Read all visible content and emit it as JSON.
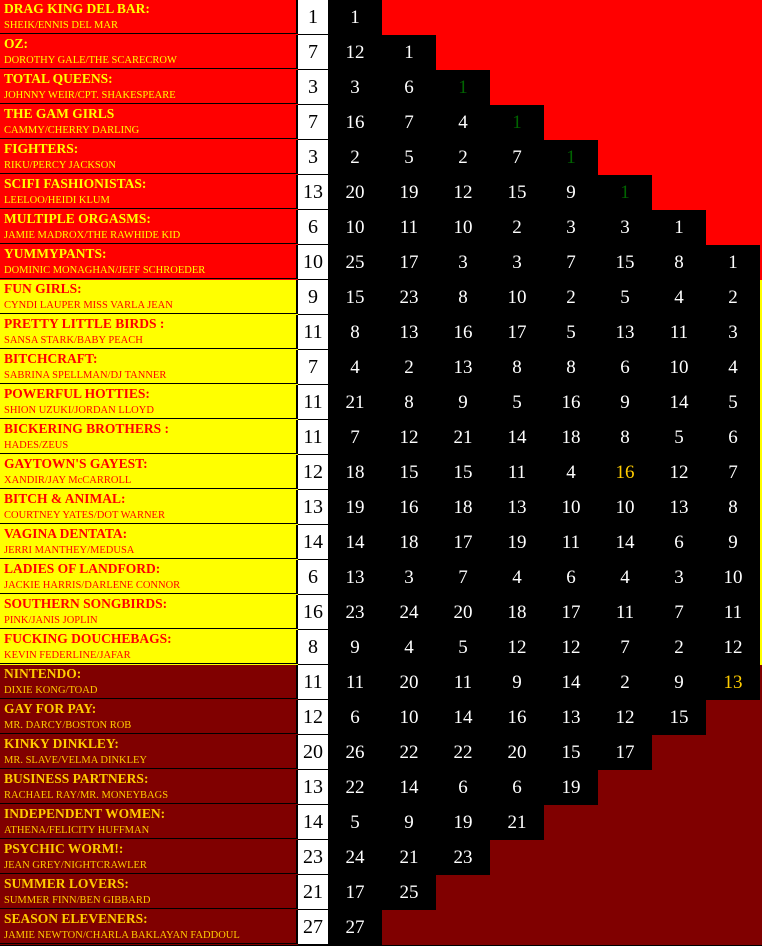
{
  "colors": {
    "red_group": "#ff0000",
    "yellow_group": "#ffff00",
    "darkred_group": "#800000",
    "text_on_red": "#ffff00",
    "text_on_yellow": "#ff0000",
    "text_on_darkred": "#ffcc00",
    "green_highlight": "#006400",
    "gold_highlight": "#ffcc00",
    "score_bg": "#000000",
    "total_bg": "#ffffff"
  },
  "rows": [
    {
      "group": "red",
      "team": "DRAG KING DEL BAR:",
      "pair": "SHEIK/ENNIS DEL MAR",
      "total": "1",
      "scores": [
        "1"
      ]
    },
    {
      "group": "red",
      "team": "OZ:",
      "pair": "DOROTHY GALE/THE SCARECROW",
      "total": "7",
      "scores": [
        "12",
        "1"
      ]
    },
    {
      "group": "red",
      "team": "TOTAL QUEENS:",
      "pair": "JOHNNY WEIR/CPT. SHAKESPEARE",
      "total": "3",
      "scores": [
        "3",
        "6",
        {
          "value": "1",
          "highlight": "green"
        }
      ]
    },
    {
      "group": "red",
      "team": "THE GAM GIRLS",
      "pair": "CAMMY/CHERRY DARLING",
      "total": "7",
      "scores": [
        "16",
        "7",
        "4",
        {
          "value": "1",
          "highlight": "green"
        }
      ]
    },
    {
      "group": "red",
      "team": "FIGHTERS:",
      "pair": "RIKU/PERCY JACKSON",
      "total": "3",
      "scores": [
        "2",
        "5",
        "2",
        "7",
        {
          "value": "1",
          "highlight": "green"
        }
      ]
    },
    {
      "group": "red",
      "team": "SCIFI FASHIONISTAS:",
      "pair": " LEELOO/HEIDI KLUM",
      "total": "13",
      "scores": [
        "20",
        "19",
        "12",
        "15",
        "9",
        {
          "value": "1",
          "highlight": "green"
        }
      ]
    },
    {
      "group": "red",
      "team": "MULTIPLE ORGASMS:",
      "pair": "JAMIE MADROX/THE RAWHIDE KID",
      "total": "6",
      "scores": [
        "10",
        "11",
        "10",
        "2",
        "3",
        "3",
        "1"
      ]
    },
    {
      "group": "red",
      "team": "YUMMYPANTS:",
      "pair": "DOMINIC MONAGHAN/JEFF SCHROEDER",
      "total": "10",
      "scores": [
        "25",
        "17",
        "3",
        "3",
        "7",
        "15",
        "8",
        "1"
      ]
    },
    {
      "group": "yellow",
      "team": "FUN GIRLS:",
      "pair": "CYNDI LAUPER MISS VARLA JEAN",
      "total": "9",
      "scores": [
        "15",
        "23",
        "8",
        "10",
        "2",
        "5",
        "4",
        "2"
      ]
    },
    {
      "group": "yellow",
      "team": "PRETTY LITTLE BIRDS :",
      "pair": "SANSA STARK/BABY PEACH",
      "total": "11",
      "scores": [
        "8",
        "13",
        "16",
        "17",
        "5",
        "13",
        "11",
        "3"
      ]
    },
    {
      "group": "yellow",
      "team": "BITCHCRAFT:",
      "pair": "SABRINA SPELLMAN/DJ TANNER",
      "total": "7",
      "scores": [
        "4",
        "2",
        "13",
        "8",
        "8",
        "6",
        "10",
        "4"
      ]
    },
    {
      "group": "yellow",
      "team": "POWERFUL HOTTIES:",
      "pair": "SHION UZUKI/JORDAN LLOYD",
      "total": "11",
      "scores": [
        "21",
        "8",
        "9",
        "5",
        "16",
        "9",
        "14",
        "5"
      ]
    },
    {
      "group": "yellow",
      "team": "BICKERING BROTHERS :",
      "pair": " HADES/ZEUS",
      "total": "11",
      "scores": [
        "7",
        "12",
        "21",
        "14",
        "18",
        "8",
        "5",
        "6"
      ]
    },
    {
      "group": "yellow",
      "team": "GAYTOWN'S GAYEST:",
      "pair": "XANDIR/JAY McCARROLL",
      "total": "12",
      "scores": [
        "18",
        "15",
        "15",
        "11",
        "4",
        {
          "value": "16",
          "highlight": "gold"
        },
        "12",
        "7"
      ]
    },
    {
      "group": "yellow",
      "team": "BITCH & ANIMAL:",
      "pair": "COURTNEY YATES/DOT WARNER",
      "total": "13",
      "scores": [
        "19",
        "16",
        "18",
        "13",
        "10",
        "10",
        "13",
        "8"
      ]
    },
    {
      "group": "yellow",
      "team": "VAGINA DENTATA:",
      "pair": "JERRI MANTHEY/MEDUSA",
      "total": "14",
      "scores": [
        "14",
        "18",
        "17",
        "19",
        "11",
        "14",
        "6",
        "9"
      ]
    },
    {
      "group": "yellow",
      "team": "LADIES OF LANDFORD:",
      "pair": "JACKIE HARRIS/DARLENE CONNOR",
      "total": "6",
      "scores": [
        "13",
        "3",
        "7",
        "4",
        "6",
        "4",
        "3",
        "10"
      ]
    },
    {
      "group": "yellow",
      "team": "SOUTHERN SONGBIRDS:",
      "pair": "PINK/JANIS JOPLIN",
      "total": "16",
      "scores": [
        "23",
        "24",
        "20",
        "18",
        "17",
        "11",
        "7",
        "11"
      ]
    },
    {
      "group": "yellow",
      "team": "FUCKING DOUCHEBAGS:",
      "pair": "KEVIN FEDERLINE/JAFAR",
      "total": "8",
      "scores": [
        "9",
        "4",
        "5",
        "12",
        "12",
        "7",
        "2",
        "12"
      ]
    },
    {
      "group": "darkred",
      "team": "NINTENDO:",
      "pair": "DIXIE KONG/TOAD",
      "total": "11",
      "scores": [
        "11",
        "20",
        "11",
        "9",
        "14",
        "2",
        "9",
        {
          "value": "13",
          "highlight": "gold"
        }
      ]
    },
    {
      "group": "darkred",
      "team": "GAY FOR PAY:",
      "pair": "MR. DARCY/BOSTON ROB",
      "total": "12",
      "scores": [
        "6",
        "10",
        "14",
        "16",
        "13",
        "12",
        "15"
      ]
    },
    {
      "group": "darkred",
      "team": "KINKY DINKLEY:",
      "pair": "MR. SLAVE/VELMA DINKLEY",
      "total": "20",
      "scores": [
        "26",
        "22",
        "22",
        "20",
        "15",
        "17"
      ]
    },
    {
      "group": "darkred",
      "team": "BUSINESS PARTNERS:",
      "pair": "RACHAEL RAY/MR. MONEYBAGS",
      "total": "13",
      "scores": [
        "22",
        "14",
        "6",
        "6",
        "19"
      ]
    },
    {
      "group": "darkred",
      "team": "INDEPENDENT WOMEN:",
      "pair": "ATHENA/FELICITY HUFFMAN",
      "total": "14",
      "scores": [
        "5",
        "9",
        "19",
        "21"
      ]
    },
    {
      "group": "darkred",
      "team": "PSYCHIC WORM!:",
      "pair": "JEAN GREY/NIGHTCRAWLER",
      "total": "23",
      "scores": [
        "24",
        "21",
        "23"
      ]
    },
    {
      "group": "darkred",
      "team": "SUMMER LOVERS:",
      "pair": "SUMMER FINN/BEN GIBBARD",
      "total": "21",
      "scores": [
        "17",
        "25"
      ]
    },
    {
      "group": "darkred",
      "team": "SEASON ELEVENERS:",
      "pair": "JAMIE NEWTON/CHARLA BAKLAYAN FADDOUL",
      "total": "27",
      "scores": [
        "27"
      ]
    }
  ]
}
